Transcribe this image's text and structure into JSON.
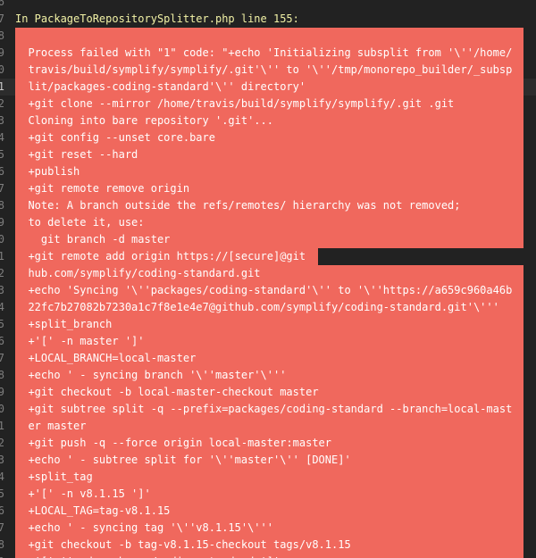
{
  "colors": {
    "background": "#222222",
    "error_bg": "#f0685d",
    "header_text": "#f2f2a6",
    "gutter": "#7f7f7f"
  },
  "lines": [
    {
      "num": "6",
      "text": "",
      "type": "plain"
    },
    {
      "num": "7",
      "text": "In PackageToRepositorySplitter.php line 155:",
      "type": "header"
    },
    {
      "num": "8",
      "text": "",
      "type": "error"
    },
    {
      "num": "9",
      "text": "  Process failed with \"1\" code: \"+echo 'Initializing subsplit from '\\''/home/",
      "type": "error"
    },
    {
      "num": "0",
      "text": "  travis/build/symplify/symplify/.git'\\'' to '\\''/tmp/monorepo_builder/_subsp",
      "type": "error"
    },
    {
      "num": "1",
      "text": "  lit/packages-coding-standard'\\'' directory'",
      "type": "error",
      "highlight": true
    },
    {
      "num": "2",
      "text": "  +git clone --mirror /home/travis/build/symplify/symplify/.git .git",
      "type": "error"
    },
    {
      "num": "3",
      "text": "  Cloning into bare repository '.git'...",
      "type": "error"
    },
    {
      "num": "4",
      "text": "  +git config --unset core.bare",
      "type": "error"
    },
    {
      "num": "5",
      "text": "  +git reset --hard",
      "type": "error"
    },
    {
      "num": "6",
      "text": "  +publish",
      "type": "error"
    },
    {
      "num": "7",
      "text": "  +git remote remove origin",
      "type": "error"
    },
    {
      "num": "8",
      "text": "  Note: A branch outside the refs/remotes/ hierarchy was not removed;",
      "type": "error"
    },
    {
      "num": "9",
      "text": "  to delete it, use:",
      "type": "error"
    },
    {
      "num": "0",
      "text": "    git branch -d master",
      "type": "error"
    },
    {
      "num": "1",
      "text": "  +git remote add origin https://[secure]@git",
      "type": "error-short"
    },
    {
      "num": "2",
      "text": "  hub.com/symplify/coding-standard.git",
      "type": "error"
    },
    {
      "num": "3",
      "text": "  +echo 'Syncing '\\''packages/coding-standard'\\'' to '\\''https://a659c960a46b",
      "type": "error"
    },
    {
      "num": "4",
      "text": "  22fc7b27082b7230a1c7f8e1e4e7@github.com/symplify/coding-standard.git'\\'''",
      "type": "error"
    },
    {
      "num": "5",
      "text": "  +split_branch",
      "type": "error"
    },
    {
      "num": "6",
      "text": "  +'[' -n master ']'",
      "type": "error"
    },
    {
      "num": "7",
      "text": "  +LOCAL_BRANCH=local-master",
      "type": "error"
    },
    {
      "num": "8",
      "text": "  +echo ' - syncing branch '\\''master'\\'''",
      "type": "error"
    },
    {
      "num": "9",
      "text": "  +git checkout -b local-master-checkout master",
      "type": "error"
    },
    {
      "num": "0",
      "text": "  +git subtree split -q --prefix=packages/coding-standard --branch=local-mast",
      "type": "error"
    },
    {
      "num": "1",
      "text": "  er master",
      "type": "error"
    },
    {
      "num": "2",
      "text": "  +git push -q --force origin local-master:master",
      "type": "error"
    },
    {
      "num": "3",
      "text": "  +echo ' - subtree split for '\\''master'\\'' [DONE]'",
      "type": "error"
    },
    {
      "num": "4",
      "text": "  +split_tag",
      "type": "error"
    },
    {
      "num": "5",
      "text": "  +'[' -n v8.1.15 ']'",
      "type": "error"
    },
    {
      "num": "6",
      "text": "  +LOCAL_TAG=tag-v8.1.15",
      "type": "error"
    },
    {
      "num": "7",
      "text": "  +echo ' - syncing tag '\\''v8.1.15'\\'''",
      "type": "error"
    },
    {
      "num": "8",
      "text": "  +git checkout -b tag-v8.1.15-checkout tags/v8.1.15",
      "type": "error"
    },
    {
      "num": "9",
      "text": "  +'[' '' -d packages/coding-standard ']'",
      "type": "error"
    }
  ]
}
